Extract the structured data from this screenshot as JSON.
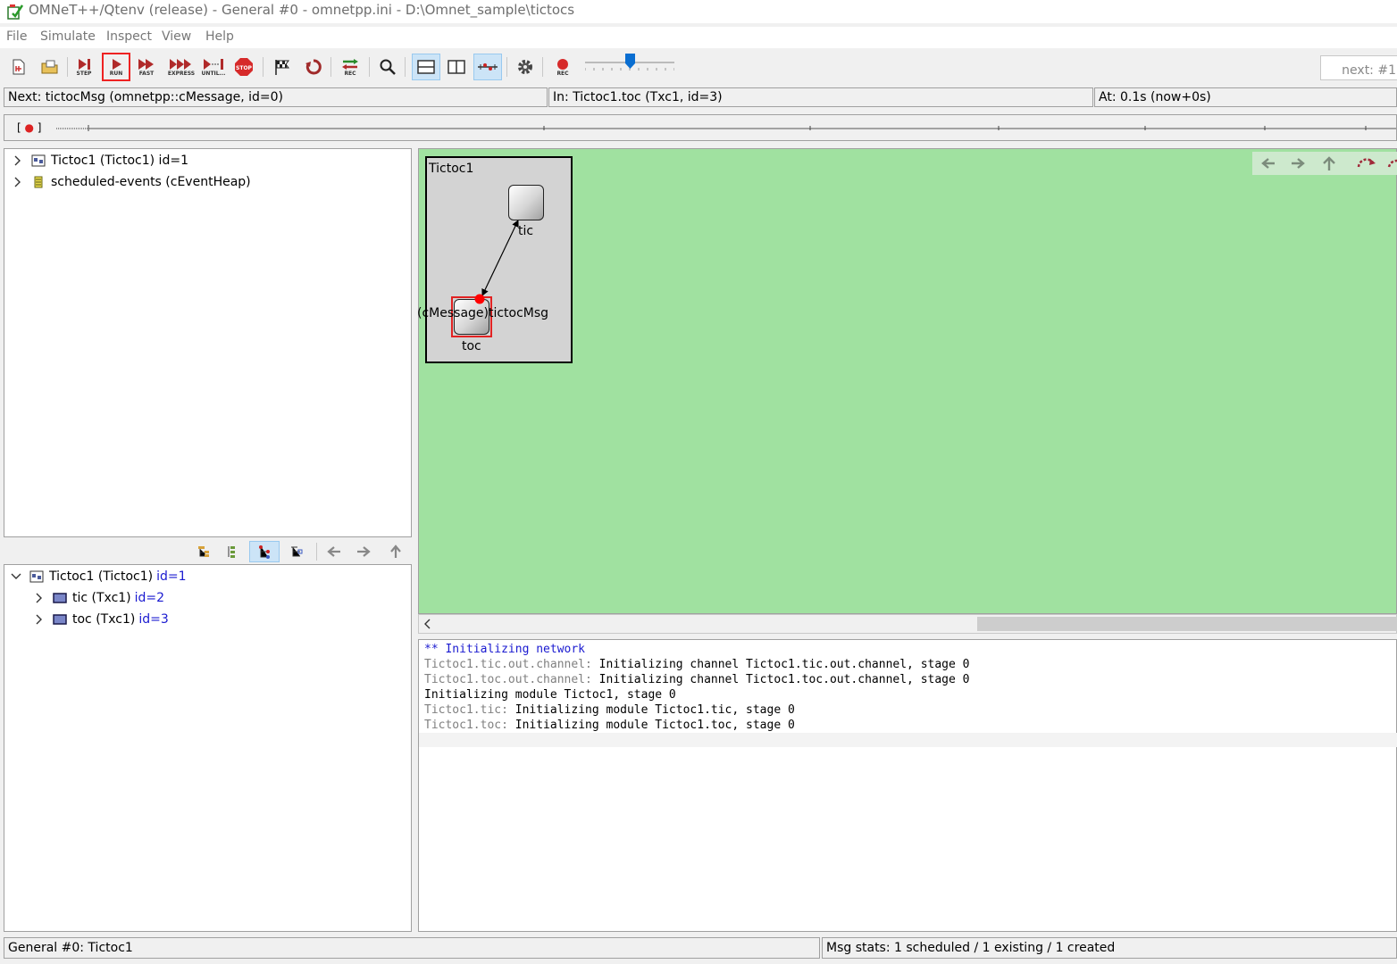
{
  "window": {
    "title": "OMNeT++/Qtenv (release) - General #0 - omnetpp.ini - D:\\Omnet_sample\\tictocs"
  },
  "menu": [
    "File",
    "Simulate",
    "Inspect",
    "View",
    "Help"
  ],
  "toolbar": {
    "step": "STEP",
    "run": "RUN",
    "fast": "FAST",
    "express": "EXPRESS",
    "until": "UNTIL...",
    "stop": "STOP",
    "rec_network": "REC",
    "rec": "REC",
    "next_event": "next: #1"
  },
  "status": {
    "next": "Next: tictocMsg (omnetpp::cMessage, id=0)",
    "in": "In: Tictoc1.toc (Txc1, id=3)",
    "at": "At: 0.1s (now+0s)"
  },
  "timeline": {
    "marker": "[ ● ]"
  },
  "object_tree": [
    {
      "label": "Tictoc1 (Tictoc1) id=1",
      "icon": "network-icon"
    },
    {
      "label": "scheduled-events (cEventHeap)",
      "icon": "event-heap-icon"
    }
  ],
  "module_tree": {
    "root": {
      "label": "Tictoc1 (Tictoc1)",
      "id": "id=1"
    },
    "children": [
      {
        "label": "tic (Txc1)",
        "id": "id=2"
      },
      {
        "label": "toc (Txc1)",
        "id": "id=3"
      }
    ]
  },
  "network": {
    "title": "Tictoc1",
    "modules": {
      "tic": "tic",
      "toc": "toc"
    },
    "message_label": "(cMessage)tictocMsg",
    "colors": {
      "canvas": "#a0e1a0",
      "compound": "#d3d3d3",
      "message": "#ff0000",
      "highlight": "#e22222"
    }
  },
  "log": [
    {
      "style": "blue",
      "source": "",
      "text": "** Initializing network"
    },
    {
      "style": "mixed",
      "source": "Tictoc1.tic.out.channel:",
      "text": "Initializing channel Tictoc1.tic.out.channel, stage 0"
    },
    {
      "style": "mixed",
      "source": "Tictoc1.toc.out.channel:",
      "text": "Initializing channel Tictoc1.toc.out.channel, stage 0"
    },
    {
      "style": "plain",
      "source": "",
      "text": "Initializing module Tictoc1, stage 0"
    },
    {
      "style": "mixed",
      "source": "Tictoc1.tic:",
      "text": "Initializing module Tictoc1.tic, stage 0"
    },
    {
      "style": "mixed",
      "source": "Tictoc1.toc:",
      "text": "Initializing module Tictoc1.toc, stage 0"
    }
  ],
  "bottom_status": {
    "config": "General #0: Tictoc1",
    "msg_stats": "Msg stats: 1 scheduled / 1 existing / 1 created"
  }
}
